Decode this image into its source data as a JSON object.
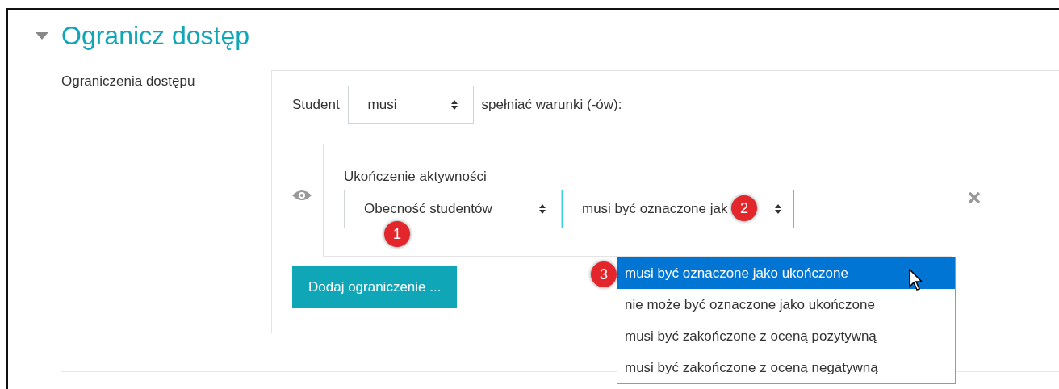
{
  "section": {
    "title": "Ogranicz dostęp",
    "expanded": true
  },
  "field_label": "Ograniczenia dostępu",
  "restriction": {
    "prefix": "Student",
    "mode": "musi",
    "suffix": "spełniać warunki (-ów):",
    "condition": {
      "title": "Ukończenie aktywności",
      "activity": "Obecność studentów",
      "requirement": "musi być oznaczone jak",
      "focused": true
    },
    "add_button": "Dodaj ograniczenie ..."
  },
  "dropdown": [
    {
      "label": "musi być oznaczone jako ukończone",
      "selected": true
    },
    {
      "label": "nie może być oznaczone jako ukończone",
      "selected": false
    },
    {
      "label": "musi być zakończone z oceną pozytywną",
      "selected": false
    },
    {
      "label": "musi być zakończone z oceną negatywną",
      "selected": false
    }
  ],
  "callouts": [
    "1",
    "2",
    "3"
  ]
}
